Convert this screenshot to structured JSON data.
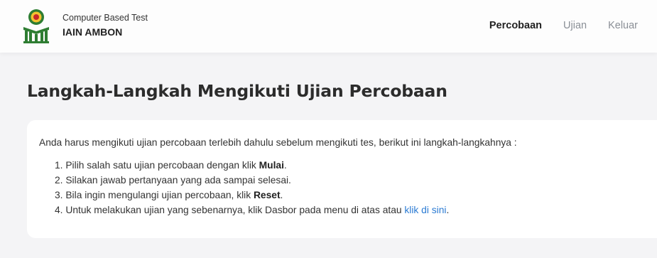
{
  "header": {
    "subtitle": "Computer Based Test",
    "title": "IAIN AMBON",
    "nav": [
      {
        "label": "Percobaan",
        "active": true
      },
      {
        "label": "Ujian",
        "active": false
      },
      {
        "label": "Keluar",
        "active": false
      }
    ]
  },
  "main": {
    "title": "Langkah-Langkah Mengikuti Ujian Percobaan",
    "intro": "Anda harus mengikuti ujian percobaan terlebih dahulu sebelum mengikuti tes, berikut ini langkah-langkahnya :",
    "steps": [
      {
        "num": "1.",
        "before": "Pilih salah satu ujian percobaan dengan klik ",
        "bold": "Mulai",
        "after": "."
      },
      {
        "num": "2.",
        "text": "Silakan jawab pertanyaan yang ada sampai selesai."
      },
      {
        "num": "3.",
        "before": "Bila ingin mengulangi ujian percobaan, klik ",
        "bold": "Reset",
        "after": "."
      },
      {
        "num": "4.",
        "before": "Untuk melakukan ujian yang sebenarnya, klik Dasbor pada menu di atas atau ",
        "link": "klik di sini",
        "after": "."
      }
    ]
  },
  "colors": {
    "background": "#f4f4f6",
    "link": "#2b7bd3",
    "nav_inactive": "#8a8f96",
    "logo_green": "#2e7d32",
    "logo_yellow": "#f2c230"
  },
  "icons": {
    "logo": "iain-ambon-logo"
  }
}
